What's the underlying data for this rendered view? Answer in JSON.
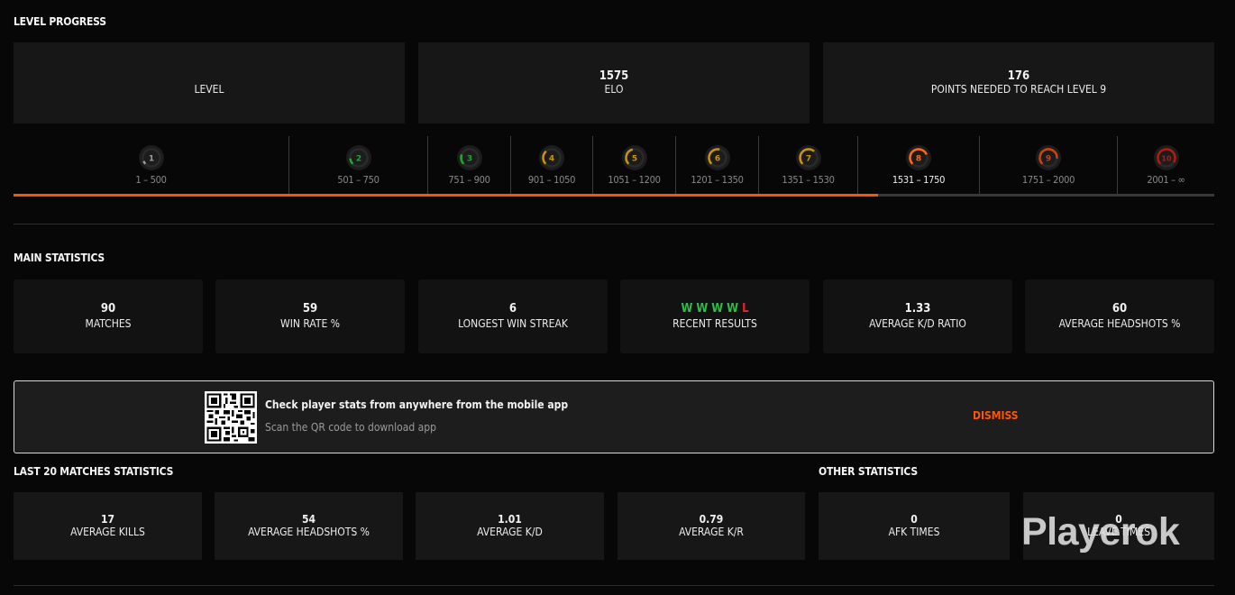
{
  "level_progress": {
    "title": "LEVEL PROGRESS",
    "level_card": {
      "value": "",
      "label": "LEVEL"
    },
    "elo_card": {
      "value": "1575",
      "label": "ELO"
    },
    "points_card": {
      "value": "176",
      "label": "POINTS NEEDED TO REACH LEVEL 9"
    },
    "current_level": 8,
    "progress_fraction": 0.72,
    "levels": [
      {
        "level": "1",
        "range": "1 – 500",
        "color": "#9a9a9a",
        "fill": 0.08
      },
      {
        "level": "2",
        "range": "501 – 750",
        "color": "#1fa82f",
        "fill": 0.15
      },
      {
        "level": "3",
        "range": "751 – 900",
        "color": "#1fa82f",
        "fill": 0.25
      },
      {
        "level": "4",
        "range": "901 – 1050",
        "color": "#c9930e",
        "fill": 0.35
      },
      {
        "level": "5",
        "range": "1051 – 1200",
        "color": "#c9930e",
        "fill": 0.45
      },
      {
        "level": "6",
        "range": "1201 – 1350",
        "color": "#c9930e",
        "fill": 0.55
      },
      {
        "level": "7",
        "range": "1351 – 1530",
        "color": "#c9930e",
        "fill": 0.65
      },
      {
        "level": "8",
        "range": "1531 – 1750",
        "color": "#ff6a13",
        "fill": 0.75
      },
      {
        "level": "9",
        "range": "1751 – 2000",
        "color": "#c5470f",
        "fill": 0.85
      },
      {
        "level": "10",
        "range": "2001 – ∞",
        "color": "#b41a0e",
        "fill": 0.95
      }
    ]
  },
  "main_statistics": {
    "title": "MAIN STATISTICS",
    "cards": [
      {
        "value": "90",
        "label": "MATCHES"
      },
      {
        "value": "59",
        "label": "WIN RATE %"
      },
      {
        "value": "6",
        "label": "LONGEST WIN STREAK"
      },
      {
        "value": "",
        "label": "RECENT RESULTS"
      },
      {
        "value": "1.33",
        "label": "AVERAGE K/D RATIO"
      },
      {
        "value": "60",
        "label": "AVERAGE HEADSHOTS %"
      }
    ],
    "recent_results": [
      "W",
      "W",
      "W",
      "W",
      "L"
    ]
  },
  "banner": {
    "icon": "qr-code-icon",
    "headline": "Check player stats from anywhere from the mobile app",
    "sub": "Scan the QR code to download app",
    "dismiss_label": "DISMISS"
  },
  "last20": {
    "title": "LAST 20 MATCHES STATISTICS",
    "cards": [
      {
        "value": "17",
        "label": "AVERAGE KILLS"
      },
      {
        "value": "54",
        "label": "AVERAGE HEADSHOTS %"
      },
      {
        "value": "1.01",
        "label": "AVERAGE K/D"
      },
      {
        "value": "0.79",
        "label": "AVERAGE K/R"
      }
    ]
  },
  "other": {
    "title": "OTHER STATISTICS",
    "cards": [
      {
        "value": "0",
        "label": "AFK TIMES"
      },
      {
        "value": "0",
        "label": "LEAVE TIMES"
      }
    ]
  },
  "watermark": "Playerok",
  "colors": {
    "accent": "#ff5500",
    "win": "#2dbf4a",
    "loss": "#e8242e"
  }
}
